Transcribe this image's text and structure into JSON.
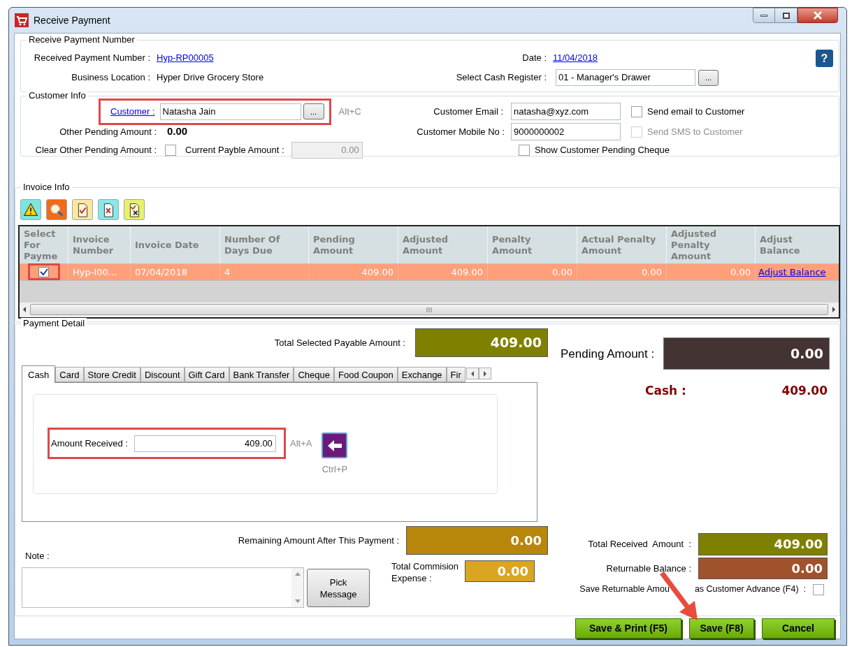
{
  "window": {
    "title": "Receive Payment"
  },
  "receive_payment_number": {
    "legend": "Receive Payment Number",
    "number_label": "Received Payment Number :",
    "number": "Hyp-RP00005",
    "date_label": "Date :",
    "date": "11/04/2018",
    "help": "?",
    "location_label": "Business Location :",
    "location": "Hyper Drive Grocery Store",
    "register_label": "Select Cash Register :",
    "register": "01 - Manager's Drawer",
    "register_button": "..."
  },
  "customer_info": {
    "legend": "Customer Info",
    "customer_label": "Customer :",
    "customer": "Natasha Jain",
    "customer_button": "...",
    "customer_shortcut": "Alt+C",
    "other_pending_label": "Other Pending Amount :",
    "other_pending": "0.00",
    "clear_other_label": "Clear Other Pending Amount :",
    "clear_other_checked": false,
    "current_payable_label": "Current Payble Amount :",
    "current_payable": "0.00",
    "email_label": "Customer Email :",
    "email": "natasha@xyz.com",
    "mobile_label": "Customer Mobile No  :",
    "mobile": "9000000002",
    "options": [
      {
        "label": "Send email to Customer",
        "checked": false,
        "disabled": false
      },
      {
        "label": "Send SMS to Customer",
        "checked": false,
        "disabled": true
      },
      {
        "label": "Show Customer Pending Cheque",
        "checked": false,
        "disabled": false
      }
    ]
  },
  "invoice_info": {
    "legend": "Invoice Info",
    "toolbar": [
      {
        "kind": "warning"
      },
      {
        "kind": "search"
      },
      {
        "kind": "check"
      },
      {
        "kind": "cross"
      },
      {
        "kind": "check-cross"
      }
    ],
    "table": {
      "columns": [
        "Select For Payme",
        "Invoice Number",
        "Invoice Date",
        "Number Of Days Due",
        "Pending Amount",
        "Adjusted Amount",
        "Penalty Amount",
        "Actual Penalty Amount",
        "Adjusted Penalty Amount",
        "Adjust Balance"
      ],
      "rows": [
        {
          "selected": true,
          "checked": true,
          "invoice_number": "Hyp-I00...",
          "invoice_date": "07/04/2018",
          "days_due": "4",
          "pending": "409.00",
          "adjusted": "409.00",
          "penalty": "0.00",
          "actual_penalty": "0.00",
          "adjusted_penalty": "0.00",
          "adjust_link": "Adjust Balance"
        }
      ]
    }
  },
  "payment_detail": {
    "legend": "Payment Detail",
    "total_label": "Total Selected Payable Amount  :",
    "total": "409.00",
    "tabs": [
      {
        "label": "Cash",
        "selected": true
      },
      {
        "label": "Card",
        "selected": false
      },
      {
        "label": "Store Credit",
        "selected": false
      },
      {
        "label": "Discount",
        "selected": false
      },
      {
        "label": "Gift Card",
        "selected": false
      },
      {
        "label": "Bank Transfer",
        "selected": false
      },
      {
        "label": "Cheque",
        "selected": false
      },
      {
        "label": "Food Coupon",
        "selected": false
      },
      {
        "label": "Exchange",
        "selected": false
      },
      {
        "label": "Fir",
        "selected": false
      }
    ],
    "amount_label": "Amount Received :",
    "amount": "409.00",
    "amount_shortcut": "Alt+A",
    "apply_shortcut": "Ctrl+P",
    "remaining_label": "Remaining Amount After This Payment :",
    "remaining": "0.00",
    "note_label": "Note :",
    "pick_button": "Pick Message",
    "commission_label": "Total Commision Expense :",
    "commission": "0.00"
  },
  "summary": {
    "pending_label": "Pending Amount :",
    "pending": "0.00",
    "methods": [
      {
        "label": "Cash :",
        "amount": "409.00"
      }
    ],
    "total_received_label": "Total Received  Amount  :",
    "total_received": "409.00",
    "returnable_label": "Returnable Balance :",
    "returnable": "0.00",
    "advance_label_start": "Save Returnable Amou",
    "advance_label_end": "as Customer Advance (F4)  :",
    "advance_checked": false
  },
  "buttons": [
    {
      "label": "Save & Print (F5)"
    },
    {
      "label": "Save (F8)"
    },
    {
      "label": "Cancel"
    }
  ]
}
